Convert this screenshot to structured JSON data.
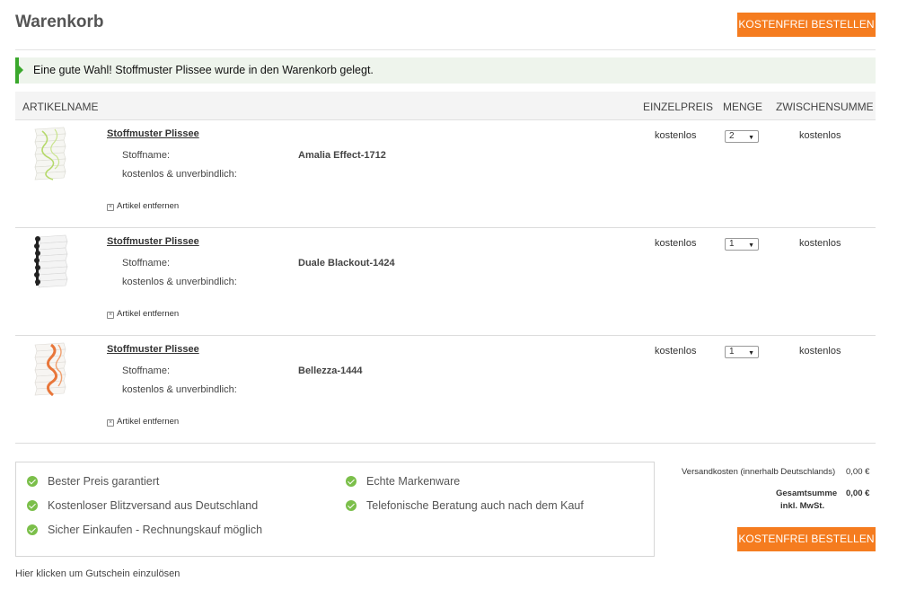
{
  "header": {
    "title": "Warenkorb",
    "order_button_label": "KOSTENFREI BESTELLEN"
  },
  "notice": {
    "text": "Eine gute Wahl! Stoffmuster Plissee wurde in den Warenkorb gelegt."
  },
  "table": {
    "columns": [
      "ARTIKELNAME",
      "EINZELPREIS",
      "MENGE",
      "ZWISCHENSUMME"
    ],
    "items": [
      {
        "name": "Stoffmuster Plissee",
        "option_label": "Stoffname:",
        "option_value": "Amalia Effect-1712",
        "note": "kostenlos & unverbindlich:",
        "remove_label": "Artikel entfernen",
        "price": "kostenlos",
        "qty": "2",
        "subtotal": "kostenlos",
        "thumb_color": "#b5d96a"
      },
      {
        "name": "Stoffmuster Plissee",
        "option_label": "Stoffname:",
        "option_value": "Duale Blackout-1424",
        "note": "kostenlos & unverbindlich:",
        "remove_label": "Artikel entfernen",
        "price": "kostenlos",
        "qty": "1",
        "subtotal": "kostenlos",
        "thumb_color": "#222222"
      },
      {
        "name": "Stoffmuster Plissee",
        "option_label": "Stoffname:",
        "option_value": "Bellezza-1444",
        "note": "kostenlos & unverbindlich:",
        "remove_label": "Artikel entfernen",
        "price": "kostenlos",
        "qty": "1",
        "subtotal": "kostenlos",
        "thumb_color": "#e8763a"
      }
    ]
  },
  "benefits": [
    "Bester Preis garantiert",
    "Echte Markenware",
    "Kostenloser Blitzversand aus Deutschland",
    "Telefonische Beratung auch nach dem Kauf",
    "Sicher Einkaufen - Rechnungskauf möglich"
  ],
  "totals": {
    "shipping_label": "Versandkosten (innerhalb Deutschlands)",
    "shipping_value": "0,00 €",
    "total_label": "Gesamtsumme",
    "total_sublabel": "inkl. MwSt.",
    "total_value": "0,00 €"
  },
  "voucher_link": "Hier klicken um Gutschein einzulösen",
  "colors": {
    "accent": "#f57c1f",
    "success": "#3aa82c",
    "check": "#7bbf4a"
  }
}
